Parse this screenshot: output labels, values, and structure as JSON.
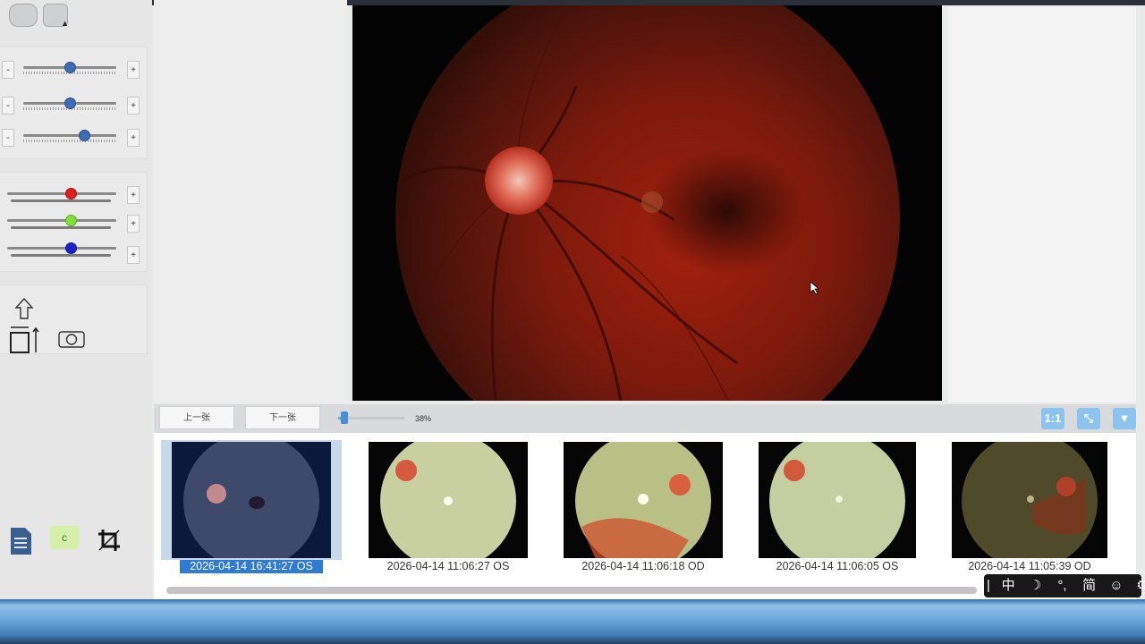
{
  "navigation": {
    "prev_label": "上一张",
    "next_label": "下一张",
    "zoom_percent": 38,
    "zoom_label": "38%",
    "ratio_label": "1:1"
  },
  "adjust_sliders": [
    {
      "name": "brightness",
      "value": 0.5
    },
    {
      "name": "contrast",
      "value": 0.5
    },
    {
      "name": "gamma",
      "value": 0.65
    }
  ],
  "channel_sliders": [
    {
      "name": "red",
      "value": 0.58,
      "color": "#e02020"
    },
    {
      "name": "green",
      "value": 0.58,
      "color": "#7fe23a"
    },
    {
      "name": "blue",
      "value": 0.58,
      "color": "#2121cc"
    }
  ],
  "buttons": {
    "minus": "-",
    "plus": "+"
  },
  "thumbnails": [
    {
      "label": "2026-04-14 16:41:27 OS",
      "selected": true
    },
    {
      "label": "2026-04-14 11:06:27 OS",
      "selected": false
    },
    {
      "label": "2026-04-14 11:06:18 OD",
      "selected": false
    },
    {
      "label": "2026-04-14 11:06:05 OS",
      "selected": false
    },
    {
      "label": "2026-04-14 11:05:39 OD",
      "selected": false
    }
  ],
  "ime": {
    "items": [
      "中",
      "☽",
      "°,",
      "简",
      "☺",
      "⚙"
    ]
  },
  "colors": {
    "selection": "#2f7ad2",
    "accent_blue": "#8cc3ef"
  }
}
